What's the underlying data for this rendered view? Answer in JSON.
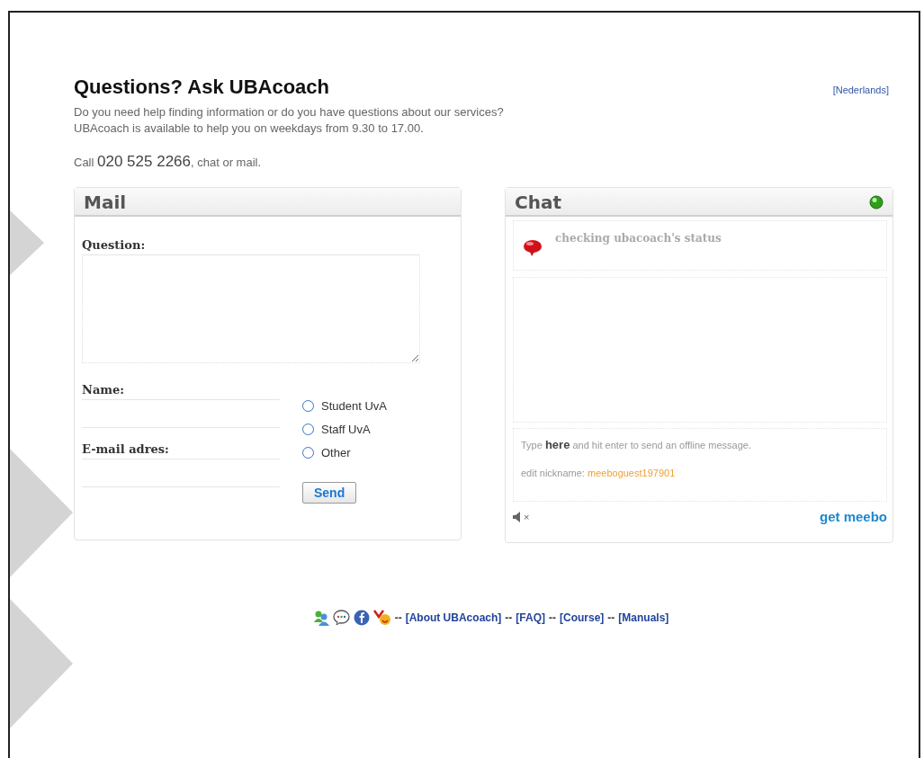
{
  "header": {
    "title": "Questions? Ask UBAcoach",
    "language_link": "[Nederlands]",
    "intro": [
      "Do you need help finding information or do you have questions about our services?",
      "UBAcoach is available to help you on weekdays from 9.30 to 17.00."
    ],
    "call": {
      "prefix": "Call",
      "phone": "020 525 2266",
      "suffix": ", chat or mail."
    }
  },
  "mail": {
    "title": "Mail",
    "question_label": "Question:",
    "name_label": "Name:",
    "email_label": "E-mail adres:",
    "options": [
      {
        "label": "Student UvA",
        "selected": false
      },
      {
        "label": "Staff UvA",
        "selected": false
      },
      {
        "label": "Other",
        "selected": false
      }
    ],
    "send": "Send"
  },
  "chat": {
    "title": "Chat",
    "status": "checking ubacoach's status",
    "hint": "Type **here** and hit enter to send an offline message.",
    "nickname_label": "edit nickname:",
    "nickname": "meeboguest197901",
    "mute": "×",
    "brand": "get meebo"
  },
  "footer": [
    {
      "kind": "sep",
      "text": "--"
    },
    {
      "kind": "link",
      "text": "[About UBAcoach]"
    },
    {
      "kind": "sep",
      "text": "--"
    },
    {
      "kind": "link",
      "text": "[FAQ]"
    },
    {
      "kind": "sep",
      "text": "--"
    },
    {
      "kind": "link",
      "text": "[Course]"
    },
    {
      "kind": "sep",
      "text": "--"
    },
    {
      "kind": "link",
      "text": "[Manuals]"
    }
  ]
}
